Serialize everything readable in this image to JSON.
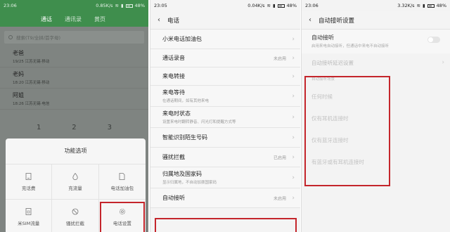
{
  "phone1": {
    "status": {
      "time": "23:06",
      "speed": "0.85K/s",
      "battery": "48%"
    },
    "tabs": [
      "通话",
      "通讯录",
      "黄页"
    ],
    "search_placeholder": "搜索(T9/全拼/首字母)",
    "contacts": [
      {
        "name": "老爸",
        "detail": "19/25  江苏无锡·移动"
      },
      {
        "name": "老妈",
        "detail": "18:20  江苏无锡·移动"
      },
      {
        "name": "阿姐",
        "detail": "18:26  江苏无锡·电信"
      }
    ],
    "dial_keys": [
      "1",
      "2",
      "3"
    ],
    "sheet": {
      "title": "功能选项",
      "items": [
        "充话费",
        "充流量",
        "电话加油包",
        "米SIM流量",
        "骚扰拦截",
        "电话设置"
      ]
    }
  },
  "phone2": {
    "status": {
      "time": "23:05",
      "speed": "0.04K/s",
      "battery": "48%"
    },
    "title": "电话",
    "items": [
      {
        "label": "小米电话加油包",
        "sub": "",
        "value": ""
      },
      {
        "label": "通话录音",
        "sub": "",
        "value": "未启用"
      },
      {
        "label": "来电转接",
        "sub": "",
        "value": ""
      },
      {
        "label": "来电等待",
        "sub": "在通话期间，如有其他来电",
        "value": ""
      },
      {
        "label": "来电时状态",
        "sub": "设置来电时翻转静音、闪光灯和提醒方式等",
        "value": ""
      },
      {
        "label": "智能识别陌生号码",
        "sub": "",
        "value": ""
      },
      {
        "label": "骚扰拦截",
        "sub": "",
        "value": "已启用"
      },
      {
        "label": "归属地及国家码",
        "sub": "显示归属地，不自动加拨国家码",
        "value": ""
      },
      {
        "label": "自动接听",
        "sub": "",
        "value": "未启用"
      }
    ]
  },
  "phone3": {
    "status": {
      "time": "23:06",
      "speed": "3.32K/s",
      "battery": "48%"
    },
    "title": "自动接听设置",
    "auto_answer": {
      "label": "自动接听",
      "sub": "启用来电自动接听，但通话中来电不自动接听"
    },
    "delay": "自动接听延迟设置",
    "section": "自动接听场景",
    "options": [
      "任何时候",
      "仅有耳机连接时",
      "仅有蓝牙连接时",
      "有蓝牙或有耳机连接时"
    ]
  }
}
